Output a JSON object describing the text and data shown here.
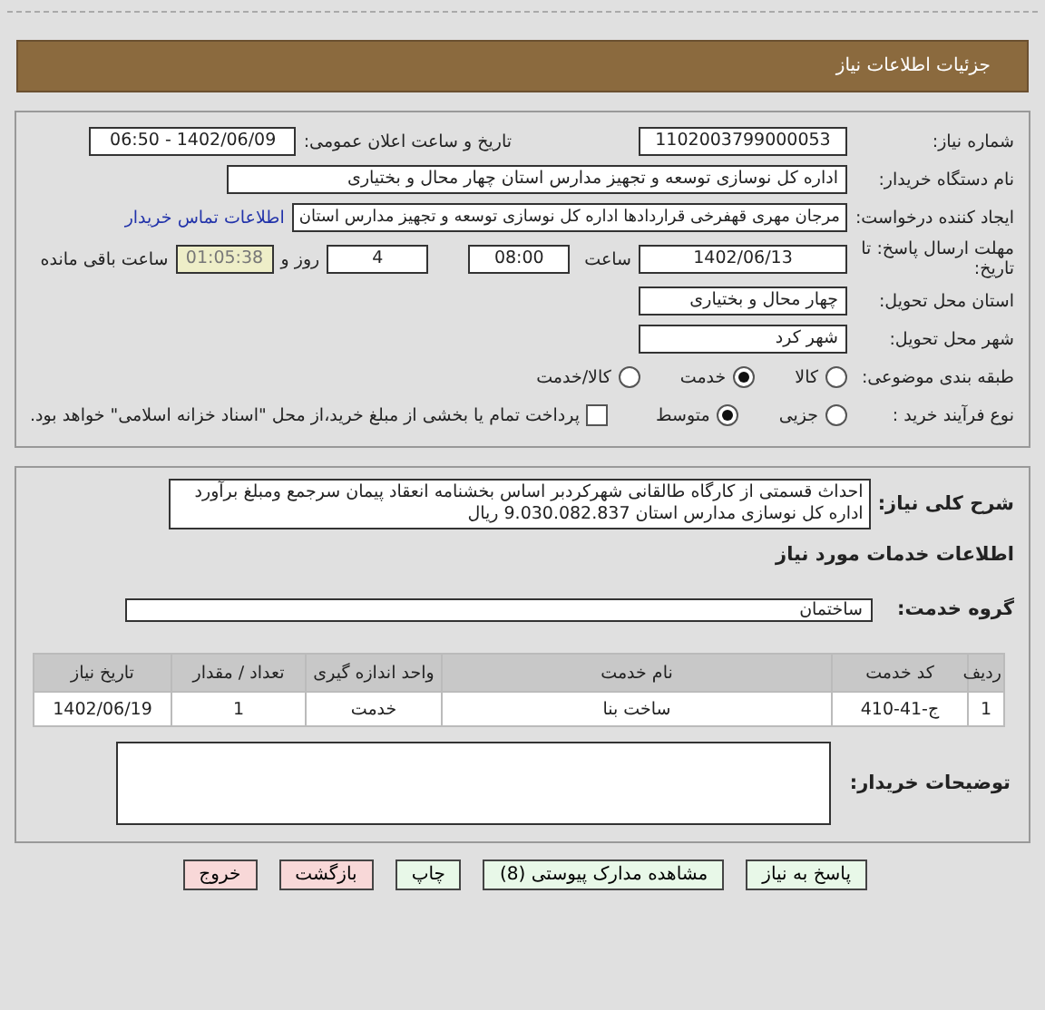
{
  "header": {
    "title": "جزئیات اطلاعات نیاز"
  },
  "need": {
    "need_number": {
      "label": "شماره نیاز:",
      "value": "1102003799000053"
    },
    "announce": {
      "label": "تاریخ و ساعت اعلان عمومی:",
      "value": "1402/06/09 - 06:50"
    },
    "buyer_org": {
      "label": "نام دستگاه خریدار:",
      "value": "اداره کل نوسازی  توسعه و تجهیز مدارس استان چهار محال و بختیاری"
    },
    "requester": {
      "label": "ایجاد کننده درخواست:",
      "value": "مرجان مهری قهفرخی قراردادها اداره کل نوسازی  توسعه و تجهیز مدارس استان",
      "link": "اطلاعات تماس خریدار"
    },
    "deadline": {
      "label": "مهلت ارسال پاسخ: تا تاریخ:",
      "date": "1402/06/13",
      "time_label": "ساعت",
      "time": "08:00",
      "days": "4",
      "days_label": "روز و",
      "remaining": "01:05:38",
      "remaining_label": "ساعت باقی مانده"
    },
    "province": {
      "label": "استان محل تحویل:",
      "value": "چهار محال و بختیاری"
    },
    "city": {
      "label": "شهر محل تحویل:",
      "value": "شهر کرد"
    },
    "category": {
      "label": "طبقه بندی موضوعی:",
      "options": [
        {
          "label": "کالا",
          "selected": false
        },
        {
          "label": "خدمت",
          "selected": true
        },
        {
          "label": "کالا/خدمت",
          "selected": false
        }
      ]
    },
    "process": {
      "label": "نوع فرآیند خرید :",
      "options": [
        {
          "label": "جزیی",
          "selected": false
        },
        {
          "label": "متوسط",
          "selected": true
        }
      ],
      "payment": {
        "label": "پرداخت تمام یا بخشی از مبلغ خرید،از محل \"اسناد خزانه اسلامی\" خواهد بود.",
        "checked": false
      }
    }
  },
  "details": {
    "description": {
      "label": "شرح کلی نیاز:",
      "value": "احداث قسمتی از کارگاه طالقانی شهرکردبر اساس بخشنامه انعقاد پیمان  سرجمع ومبلغ برآورد اداره کل نوسازی مدارس استان 9.030.082.837 ریال"
    },
    "services_title": "اطلاعات خدمات مورد نیاز",
    "service_group": {
      "label": "گروه خدمت:",
      "value": "ساختمان"
    },
    "table": {
      "columns": [
        "ردیف",
        "کد خدمت",
        "نام خدمت",
        "واحد اندازه گیری",
        "تعداد / مقدار",
        "تاریخ نیاز"
      ],
      "rows": [
        [
          "1",
          "ج-41-410",
          "ساخت بنا",
          "خدمت",
          "1",
          "1402/06/19"
        ]
      ]
    },
    "buyer_notes": {
      "label": "توضیحات خریدار:"
    }
  },
  "buttons": [
    {
      "label": "پاسخ به نیاز",
      "kind": "action"
    },
    {
      "label": "مشاهده مدارک پیوستی (8)",
      "kind": "action"
    },
    {
      "label": "چاپ",
      "kind": "action"
    },
    {
      "label": "بازگشت",
      "kind": "nav"
    },
    {
      "label": "خروج",
      "kind": "nav"
    }
  ]
}
